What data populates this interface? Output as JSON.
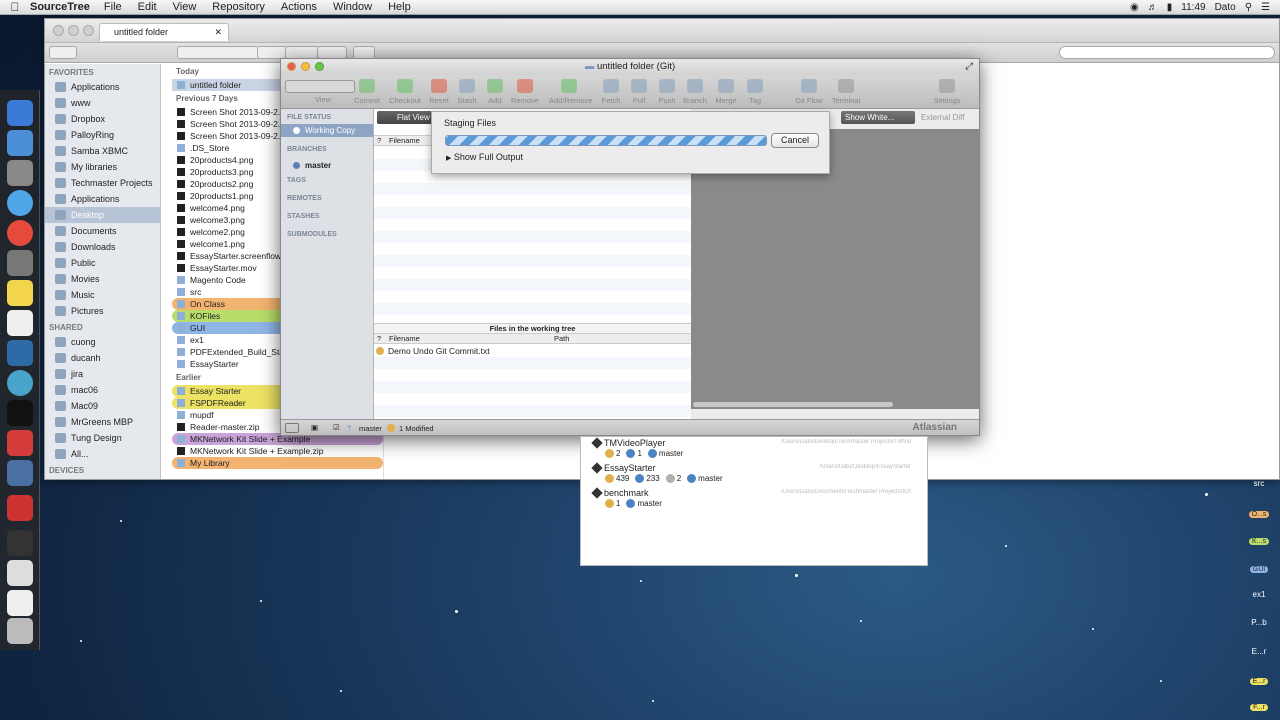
{
  "menubar": {
    "app_name": "SourceTree",
    "menus": [
      "File",
      "Edit",
      "View",
      "Repository",
      "Actions",
      "Window",
      "Help"
    ],
    "clock": "11:49",
    "user": "Dato"
  },
  "finder": {
    "title": "untitled folder",
    "sidebar": {
      "favorites_header": "FAVORITES",
      "favorites": [
        "Applications",
        "www",
        "Dropbox",
        "PalloyRing",
        "Samba XBMC",
        "My libraries",
        "Techmaster Projects",
        "Applications",
        "Desktop",
        "Documents",
        "Downloads",
        "Public",
        "Movies",
        "Music",
        "Pictures"
      ],
      "selected": "Desktop",
      "shared_header": "SHARED",
      "shared": [
        "cuong",
        "ducanh",
        "jira",
        "mac06",
        "Mac09",
        "MrGreens MBP",
        "Tung Design",
        "All..."
      ],
      "devices_header": "DEVICES"
    },
    "list": {
      "today_header": "Today",
      "today": [
        "untitled folder"
      ],
      "prev7_header": "Previous 7 Days",
      "prev7": [
        "Screen Shot 2013-09-2...",
        "Screen Shot 2013-09-2...",
        "Screen Shot 2013-09-2...",
        ".DS_Store",
        "20products4.png",
        "20products3.png",
        "20products2.png",
        "20products1.png",
        "welcome4.png",
        "welcome3.png",
        "welcome2.png",
        "welcome1.png",
        "EssayStarter.screenflow",
        "EssayStarter.mov",
        "Magento Code",
        "src",
        "On Class",
        "KOFiles",
        "GUI",
        "ex1",
        "PDFExtended_Build_Sta...",
        "EssayStarter"
      ],
      "earlier_header": "Earlier",
      "earlier": [
        "Essay Starter",
        "FSPDFReader",
        "mupdf",
        "Reader-master.zip",
        "MKNetwork Kit Slide + Example",
        "MKNetwork Kit Slide + Example.zip",
        "My Library"
      ]
    }
  },
  "sourcetree": {
    "title": "untitled folder (Git)",
    "toolbar": [
      "View",
      "Commit",
      "Checkout",
      "Reset",
      "Stash",
      "Add",
      "Remove",
      "Add/Remove",
      "Fetch",
      "Pull",
      "Push",
      "Branch",
      "Merge",
      "Tag",
      "Git Flow",
      "Terminal",
      "Settings"
    ],
    "sidebar": {
      "file_status": "FILE STATUS",
      "working_copy": "Working Copy",
      "branches": "BRANCHES",
      "branch_master": "master",
      "tags": "TAGS",
      "remotes": "REMOTES",
      "stashes": "STASHES",
      "submodules": "SUBMODULES"
    },
    "view_button": "Flat View",
    "show_whitespace": "Show White...",
    "external_diff": "External Diff",
    "staged_columns": {
      "q": "?",
      "filename": "Filename"
    },
    "working_tree_title": "Files in the working tree",
    "working_columns": {
      "q": "?",
      "filename": "Filename",
      "path": "Path"
    },
    "files": [
      "Demo Undo Git Commit.txt"
    ],
    "status": {
      "branch": "master",
      "modified": "1 Modified",
      "brand": "Atlassian"
    },
    "sheet": {
      "title": "Staging Files",
      "cancel": "Cancel",
      "show_output": "Show Full Output"
    }
  },
  "repo_list": [
    {
      "name": "TMVideoPlayer",
      "path": "/Users/Dato/Desktop/Techmaster Projects/TMVideoPla...",
      "counts": [
        "2",
        "1"
      ],
      "branch": "master"
    },
    {
      "name": "EssayStarter",
      "path": "/Users/Dato/Desktop/EssayStarter",
      "counts": [
        "439",
        "233",
        "2"
      ],
      "branch": "master"
    },
    {
      "name": "benchmark",
      "path": "/Users/Dato/Documents/Techmaster Projects/IOS/benchmark",
      "counts": [
        "1"
      ],
      "branch": "master"
    }
  ],
  "desktop_items": [
    "src",
    "O...s",
    "K...s",
    "GUI",
    "ex1",
    "P...b",
    "E...r",
    "E...r",
    "F...r"
  ]
}
